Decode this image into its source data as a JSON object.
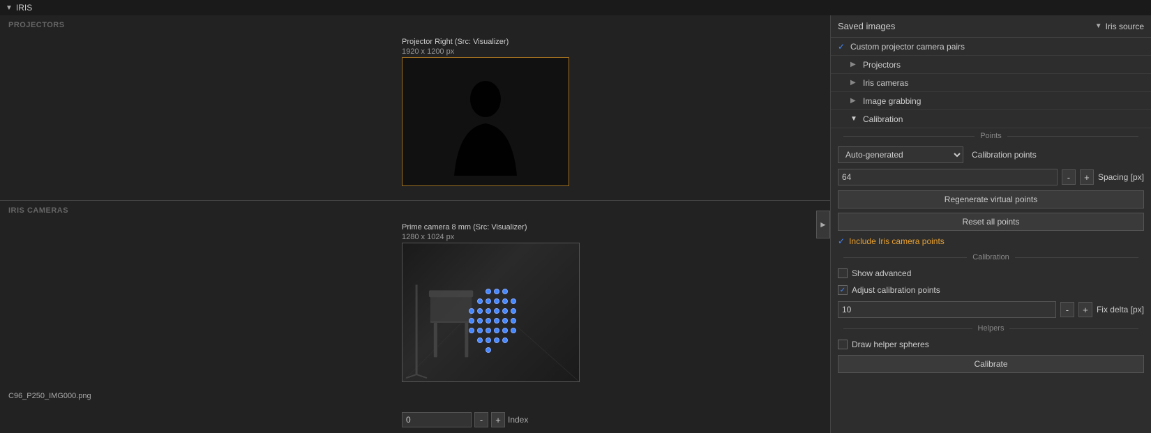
{
  "titleBar": {
    "icon": "▼",
    "title": "IRIS"
  },
  "sections": {
    "projectors": "PROJECTORS",
    "irisCameras": "IRIS CAMERAS"
  },
  "projectorImage": {
    "title": "Projector Right (Src: Visualizer)",
    "dimensions": "1920 x 1200 px"
  },
  "cameraImage": {
    "title": "Prime camera 8 mm (Src: Visualizer)",
    "dimensions": "1280 x 1024 px",
    "filename": "C96_P250_IMG000.png",
    "indexValue": "0",
    "indexLabel": "Index"
  },
  "rightPanel": {
    "savedImagesTitle": "Saved images",
    "irisSourceLabel": "Iris source",
    "menuItems": [
      {
        "id": "custom-pairs",
        "checked": true,
        "expand": false,
        "label": "Custom projector camera pairs"
      },
      {
        "id": "projectors",
        "checked": false,
        "expand": true,
        "label": "Projectors"
      },
      {
        "id": "iris-cameras",
        "checked": false,
        "expand": true,
        "label": "Iris cameras"
      },
      {
        "id": "image-grabbing",
        "checked": false,
        "expand": true,
        "label": "Image grabbing"
      },
      {
        "id": "calibration",
        "checked": false,
        "expand": false,
        "label": "Calibration",
        "collapsed": true
      }
    ],
    "points": {
      "sectionLabel": "Points",
      "autoGenerated": "Auto-generated",
      "calibrationPoints": "Calibration points",
      "spacingValue": "64",
      "spacingLabel": "Spacing [px]",
      "decrementBtn": "-",
      "incrementBtn": "+",
      "regenerateBtn": "Regenerate virtual points",
      "resetBtn": "Reset all points"
    },
    "includeIrisPoints": "Include Iris camera points",
    "calibration": {
      "sectionLabel": "Calibration",
      "showAdvanced": "Show advanced",
      "adjustCalibration": "Adjust calibration points",
      "fixDeltaValue": "10",
      "fixDeltaLabel": "Fix delta [px]",
      "decrementBtn": "-",
      "incrementBtn": "+"
    },
    "helpers": {
      "sectionLabel": "Helpers",
      "drawHelperSpheres": "Draw helper spheres"
    },
    "calibrateBtn": "Calibrate"
  },
  "buttons": {
    "decrement": "-",
    "increment": "+"
  }
}
